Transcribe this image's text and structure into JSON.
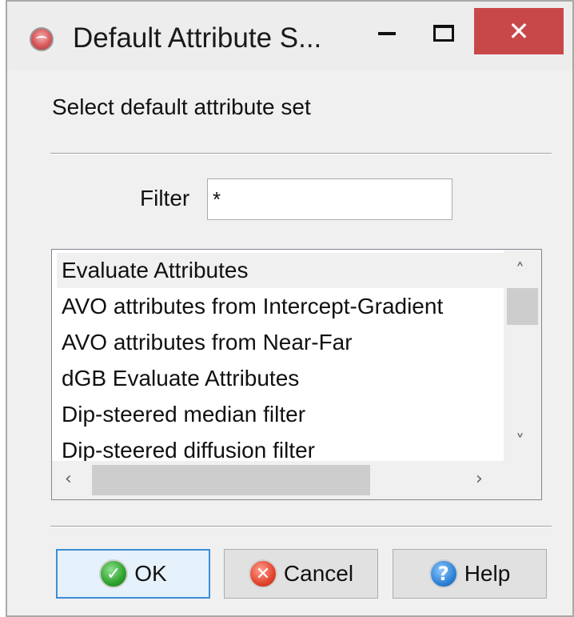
{
  "window": {
    "title": "Default Attribute S...",
    "app_icon": "opendtect-icon",
    "minimize_glyph": "",
    "maximize_glyph": "",
    "close_glyph": "✕"
  },
  "heading": "Select default attribute set",
  "filter": {
    "label": "Filter",
    "value": "*"
  },
  "list": {
    "items": [
      {
        "label": "Evaluate Attributes"
      },
      {
        "label": "AVO attributes from Intercept-Gradient"
      },
      {
        "label": "AVO attributes from Near-Far"
      },
      {
        "label": "dGB Evaluate Attributes"
      },
      {
        "label": "Dip-steered median filter"
      },
      {
        "label": "Dip-steered diffusion filter"
      }
    ],
    "scroll_up_glyph": "˄",
    "scroll_down_glyph": "˅",
    "scroll_left_glyph": "‹",
    "scroll_right_glyph": "›"
  },
  "buttons": {
    "ok": {
      "label": "OK",
      "icon": "check-icon",
      "glyph": "✓"
    },
    "cancel": {
      "label": "Cancel",
      "icon": "cancel-icon",
      "glyph": "✕"
    },
    "help": {
      "label": "Help",
      "icon": "help-icon",
      "glyph": "?"
    }
  },
  "colors": {
    "close_button": "#c8484a",
    "default_button_border": "#3c8dd6"
  }
}
